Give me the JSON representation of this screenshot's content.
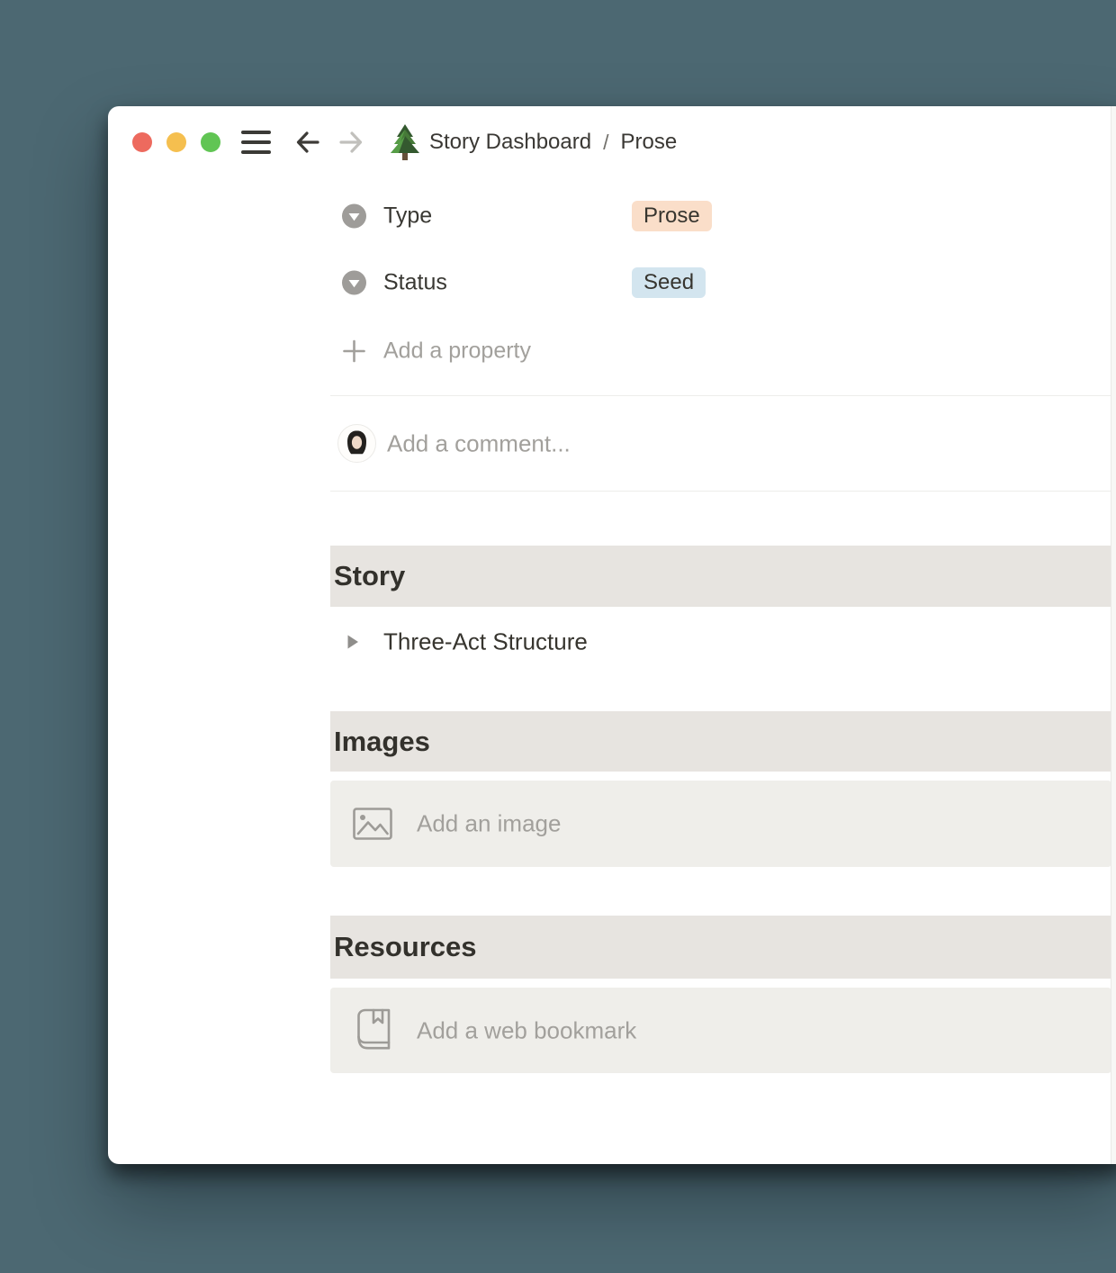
{
  "colors": {
    "desktop_bg": "#4c6872",
    "window_bg": "#ffffff",
    "heading_band_bg": "#e7e4e0",
    "placeholder_bg": "#efeeea",
    "text_primary": "#37352f",
    "text_muted": "#a2a09c",
    "divider": "#ededeb",
    "traffic_red": "#ed6a5e",
    "traffic_yellow": "#f5bf4f",
    "traffic_green": "#61c554",
    "tag_prose_bg": "#fadec9",
    "tag_seed_bg": "#d3e5ef"
  },
  "titlebar": {
    "breadcrumb": {
      "root": "Story Dashboard",
      "separator": "/",
      "current": "Prose"
    },
    "icons": {
      "menu": "hamburger-icon",
      "back": "arrow-left-icon",
      "forward": "arrow-right-icon",
      "page": "evergreen-tree-icon"
    }
  },
  "properties": {
    "rows": [
      {
        "label": "Type",
        "value": "Prose",
        "value_bg": "#fadec9",
        "icon": "select-property-icon"
      },
      {
        "label": "Status",
        "value": "Seed",
        "value_bg": "#d3e5ef",
        "icon": "select-property-icon"
      }
    ],
    "add_property": "Add a property"
  },
  "comment": {
    "placeholder": "Add a comment..."
  },
  "sections": {
    "story": {
      "heading": "Story",
      "toggle_item": "Three-Act Structure"
    },
    "images": {
      "heading": "Images",
      "placeholder": "Add an image",
      "icon": "image-icon"
    },
    "resources": {
      "heading": "Resources",
      "placeholder": "Add a web bookmark",
      "icon": "bookmark-book-icon"
    }
  }
}
